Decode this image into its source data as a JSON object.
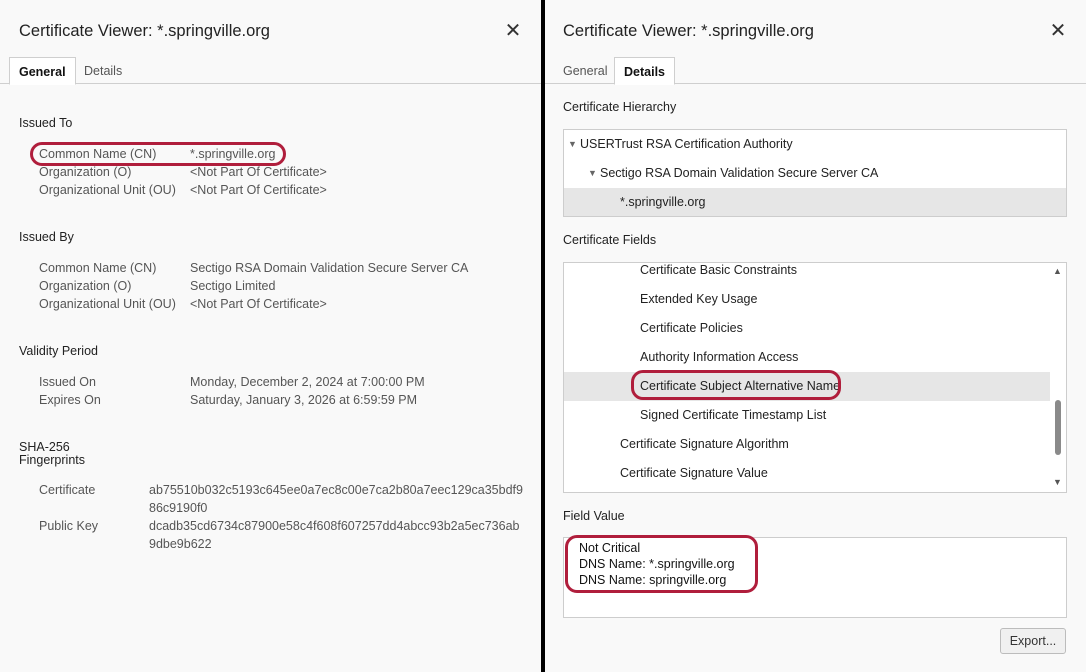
{
  "left": {
    "title": "Certificate Viewer: *.springville.org",
    "close_glyph": "✕",
    "tabs": [
      {
        "label": "General",
        "active": true
      },
      {
        "label": "Details",
        "active": false
      }
    ],
    "issued_to": {
      "heading": "Issued To",
      "rows": [
        {
          "label": "Common Name (CN)",
          "value": "*.springville.org"
        },
        {
          "label": "Organization (O)",
          "value": "<Not Part Of Certificate>"
        },
        {
          "label": "Organizational Unit (OU)",
          "value": "<Not Part Of Certificate>"
        }
      ]
    },
    "issued_by": {
      "heading": "Issued By",
      "rows": [
        {
          "label": "Common Name (CN)",
          "value": "Sectigo RSA Domain Validation Secure Server CA"
        },
        {
          "label": "Organization (O)",
          "value": "Sectigo Limited"
        },
        {
          "label": "Organizational Unit (OU)",
          "value": "<Not Part Of Certificate>"
        }
      ]
    },
    "validity": {
      "heading": "Validity Period",
      "rows": [
        {
          "label": "Issued On",
          "value": "Monday, December 2, 2024 at 7:00:00 PM"
        },
        {
          "label": "Expires On",
          "value": "Saturday, January 3, 2026 at 6:59:59 PM"
        }
      ]
    },
    "fingerprints": {
      "heading_line1": "SHA-256",
      "heading_line2": "Fingerprints",
      "rows": [
        {
          "label": "Certificate",
          "value": "ab75510b032c5193c645ee0a7ec8c00e7ca2b80a7eec129ca35bdf986c9190f0"
        },
        {
          "label": "Public Key",
          "value": "dcadb35cd6734c87900e58c4f608f607257dd4abcc93b2a5ec736ab9dbe9b622"
        }
      ]
    }
  },
  "right": {
    "title": "Certificate Viewer: *.springville.org",
    "close_glyph": "✕",
    "tabs": [
      {
        "label": "General",
        "active": false
      },
      {
        "label": "Details",
        "active": true
      }
    ],
    "hierarchy": {
      "heading": "Certificate Hierarchy",
      "items": [
        {
          "label": "USERTrust RSA Certification Authority",
          "expanded": true
        },
        {
          "label": "Sectigo RSA Domain Validation Secure Server CA",
          "expanded": true
        },
        {
          "label": "*.springville.org",
          "selected": true
        }
      ]
    },
    "fields": {
      "heading": "Certificate Fields",
      "items": [
        {
          "label": "Certificate Basic Constraints"
        },
        {
          "label": "Extended Key Usage"
        },
        {
          "label": "Certificate Policies"
        },
        {
          "label": "Authority Information Access"
        },
        {
          "label": "Certificate Subject Alternative Name",
          "selected": true
        },
        {
          "label": "Signed Certificate Timestamp List"
        },
        {
          "label": "Certificate Signature Algorithm"
        },
        {
          "label": "Certificate Signature Value"
        }
      ]
    },
    "field_value": {
      "heading": "Field Value",
      "lines": [
        "Not Critical",
        "DNS Name: *.springville.org",
        "DNS Name: springville.org"
      ]
    },
    "export_label": "Export..."
  },
  "colors": {
    "highlight": "#b01e3c",
    "selection": "#e6e6e6",
    "divider": "#000000"
  }
}
